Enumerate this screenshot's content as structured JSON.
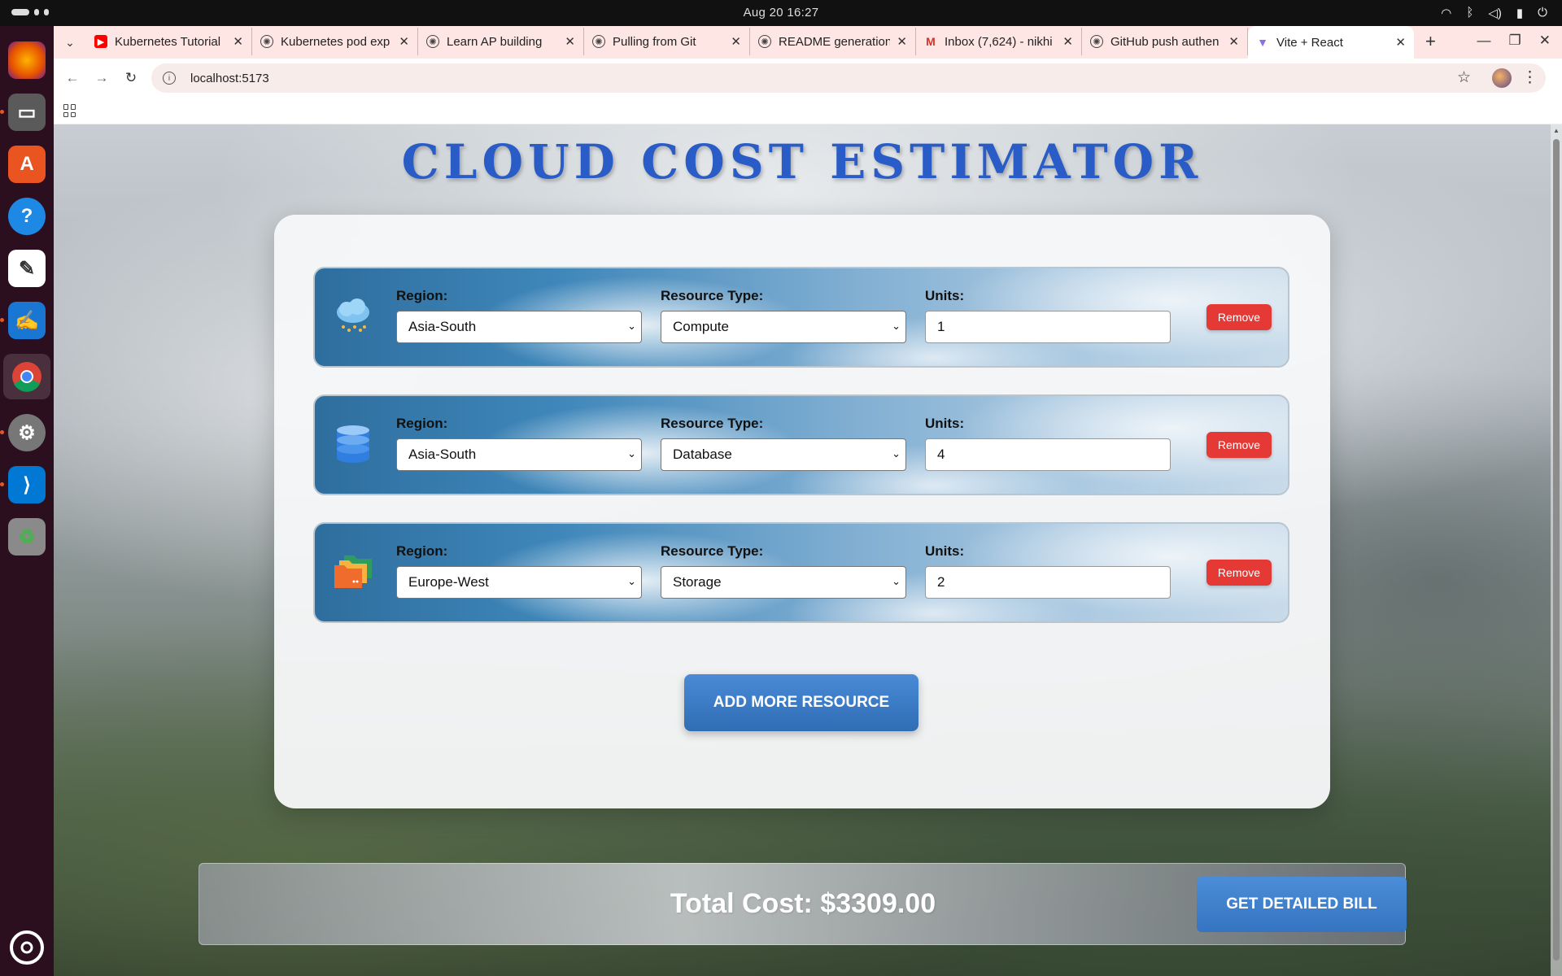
{
  "system": {
    "clock": "Aug 20  16:27"
  },
  "tabs": [
    {
      "title": "Kubernetes Tutorial",
      "icon": "youtube-icon",
      "color": "#ff0000"
    },
    {
      "title": "Kubernetes pod exp",
      "icon": "chatgpt-icon",
      "color": "#444444"
    },
    {
      "title": "Learn AP building",
      "icon": "chatgpt-icon",
      "color": "#444444"
    },
    {
      "title": "Pulling from Git",
      "icon": "chatgpt-icon",
      "color": "#444444"
    },
    {
      "title": "README generation",
      "icon": "chatgpt-icon",
      "color": "#444444"
    },
    {
      "title": "Inbox (7,624) - nikhi",
      "icon": "gmail-icon",
      "color": "#d93025"
    },
    {
      "title": "GitHub push authen",
      "icon": "chatgpt-icon",
      "color": "#444444"
    },
    {
      "title": "Vite + React",
      "icon": "vite-icon",
      "color": "#8e6cf2",
      "active": true
    }
  ],
  "address_bar": {
    "url": "localhost:5173"
  },
  "page": {
    "title": "CLOUD COST ESTIMATOR",
    "labels": {
      "region": "Region:",
      "resource_type": "Resource Type:",
      "units": "Units:",
      "remove": "Remove"
    },
    "resources": [
      {
        "icon": "cloud-rain-icon",
        "region": "Asia-South",
        "resource_type": "Compute",
        "units": "1"
      },
      {
        "icon": "database-icon",
        "region": "Asia-South",
        "resource_type": "Database",
        "units": "4"
      },
      {
        "icon": "folders-icon",
        "region": "Europe-West",
        "resource_type": "Storage",
        "units": "2"
      }
    ],
    "add_button": "ADD MORE RESOURCE",
    "total_cost": "Total Cost: $3309.00",
    "bill_button": "GET DETAILED BILL"
  },
  "colors": {
    "title": "#2a5cc7",
    "remove": "#e53935",
    "primary_button": "#3a7cc8"
  }
}
